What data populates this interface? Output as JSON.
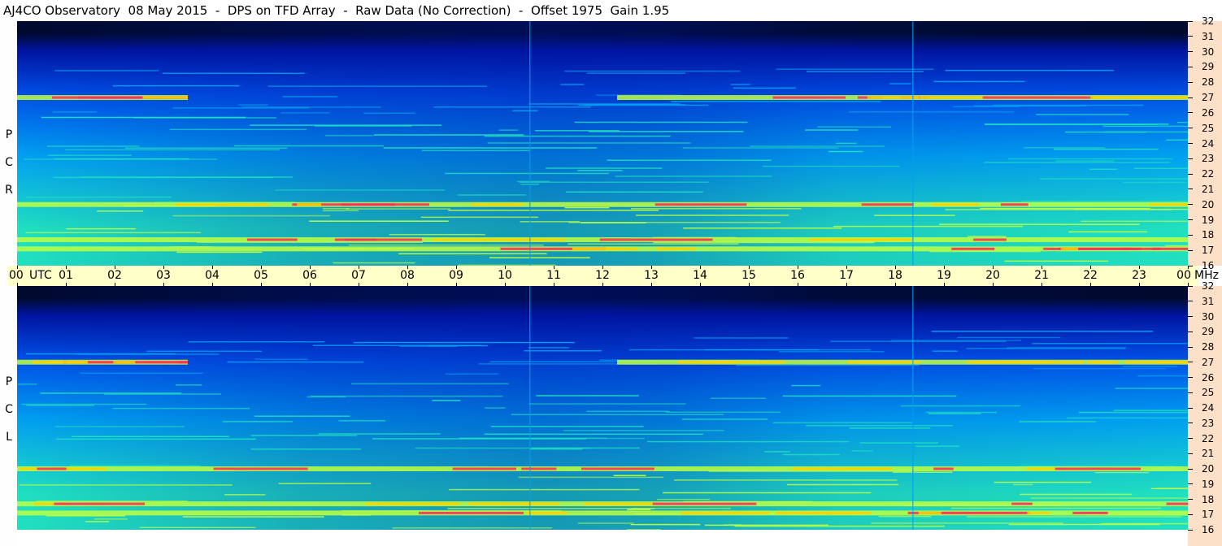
{
  "title": "AJ4CO Observatory  08 May 2015  -  DPS on TFD Array  -  Raw Data (No Correction)  -  Offset 1975  Gain 1.95",
  "panels": [
    {
      "id": "rcp",
      "label_letters": [
        "R",
        "C",
        "P"
      ]
    },
    {
      "id": "lcp",
      "label_letters": [
        "L",
        "C",
        "P"
      ]
    }
  ],
  "time_axis": {
    "labels": [
      "00",
      "01",
      "02",
      "03",
      "04",
      "05",
      "06",
      "07",
      "08",
      "09",
      "10",
      "11",
      "12",
      "13",
      "14",
      "15",
      "16",
      "17",
      "18",
      "19",
      "20",
      "21",
      "22",
      "23",
      "00"
    ],
    "unit_label": "UTC",
    "freq_unit_label": "MHz"
  },
  "chart_data": [
    {
      "type": "heatmap",
      "title": "AJ4CO Observatory  08 May 2015  -  DPS on TFD Array  -  Raw Data (No Correction)  -  Offset 1975  Gain 1.95",
      "polarization": "RCP",
      "x_label": "UTC",
      "x_ticks": [
        "00",
        "01",
        "02",
        "03",
        "04",
        "05",
        "06",
        "07",
        "08",
        "09",
        "10",
        "11",
        "12",
        "13",
        "14",
        "15",
        "16",
        "17",
        "18",
        "19",
        "20",
        "21",
        "22",
        "23",
        "00"
      ],
      "xlim_hours": [
        0,
        24
      ],
      "y_label": "MHz",
      "y_ticks": [
        16,
        17,
        18,
        19,
        20,
        21,
        22,
        23,
        24,
        25,
        26,
        27,
        28,
        29,
        30,
        31,
        32
      ],
      "ylim_mhz": [
        16,
        32
      ],
      "colormap": [
        "#000a2e",
        "#0014a0",
        "#0050e6",
        "#00a0f0",
        "#20e0c0",
        "#c0ff40",
        "#ffd000",
        "#ff3060"
      ],
      "features": {
        "bright_bands_mhz": [
          17.7,
          27.0,
          20.0,
          17.1
        ],
        "vertical_streaks_utc_hours": [
          10.5,
          18.35
        ]
      }
    },
    {
      "type": "heatmap",
      "polarization": "LCP",
      "x_label": "UTC",
      "x_ticks": [
        "00",
        "01",
        "02",
        "03",
        "04",
        "05",
        "06",
        "07",
        "08",
        "09",
        "10",
        "11",
        "12",
        "13",
        "14",
        "15",
        "16",
        "17",
        "18",
        "19",
        "20",
        "21",
        "22",
        "23",
        "00"
      ],
      "xlim_hours": [
        0,
        24
      ],
      "y_label": "MHz",
      "y_ticks": [
        16,
        17,
        18,
        19,
        20,
        21,
        22,
        23,
        24,
        25,
        26,
        27,
        28,
        29,
        30,
        31,
        32
      ],
      "ylim_mhz": [
        16,
        32
      ],
      "colormap": [
        "#000a2e",
        "#0014a0",
        "#0050e6",
        "#00a0f0",
        "#20e0c0",
        "#c0ff40",
        "#ffd000",
        "#ff3060"
      ],
      "features": {
        "bright_bands_mhz": [
          17.7,
          27.0,
          20.0,
          17.1
        ],
        "vertical_streaks_utc_hours": [
          10.5,
          18.35
        ]
      }
    }
  ]
}
